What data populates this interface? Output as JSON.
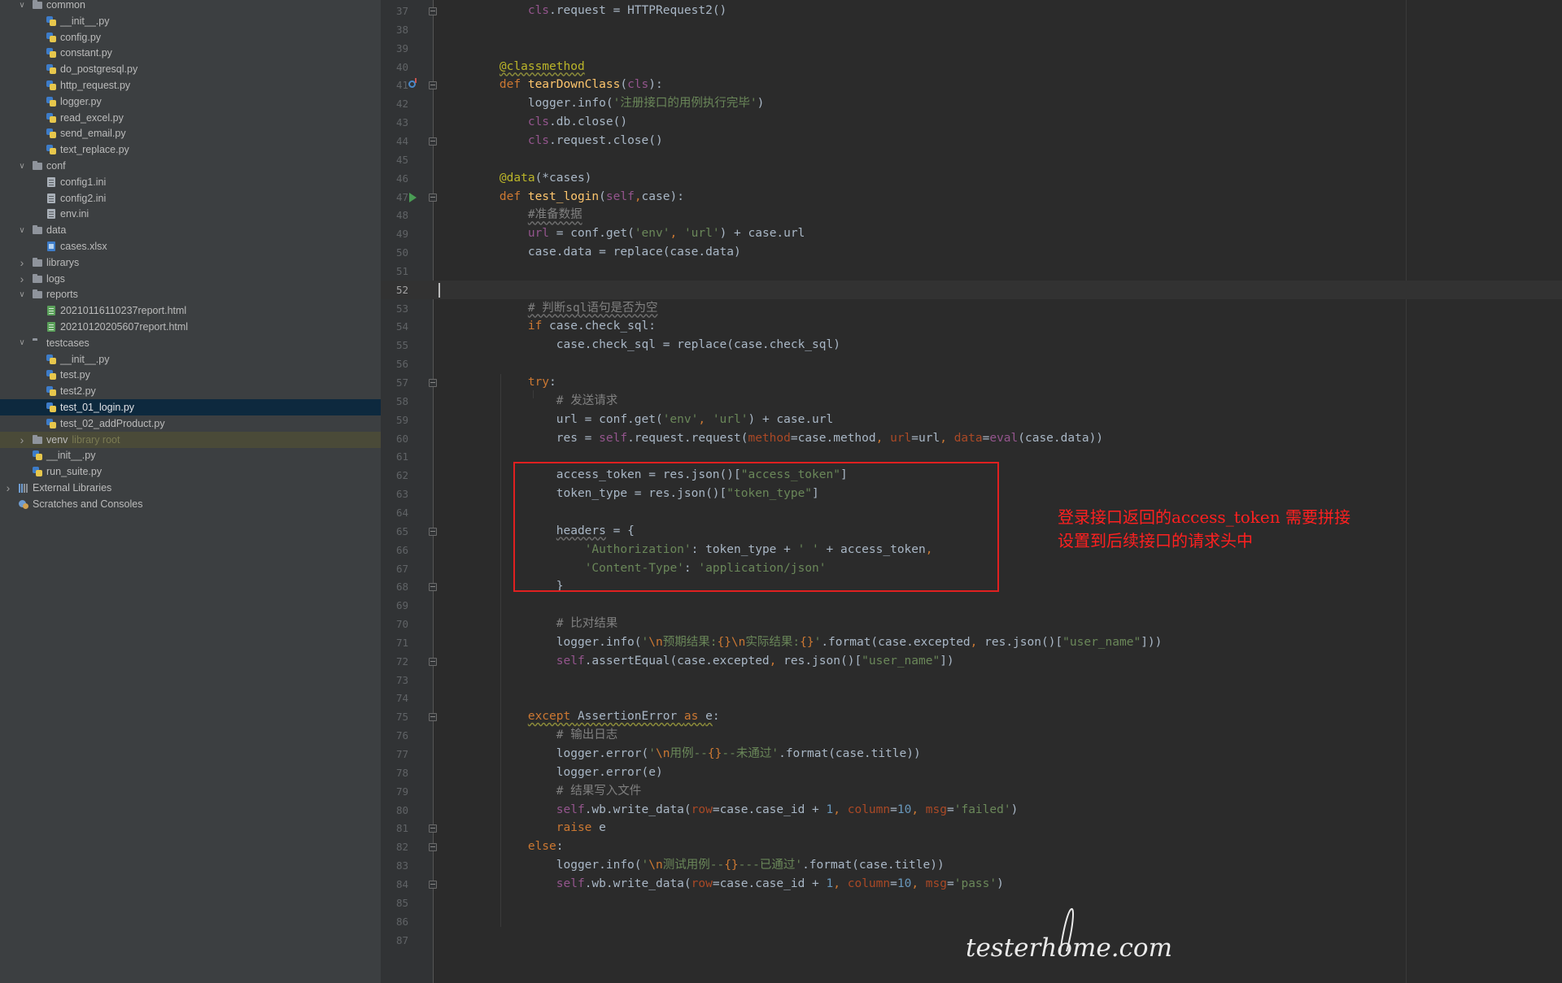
{
  "project_tree": [
    {
      "label": "common",
      "type": "folder",
      "icon": "folder-icon",
      "depth": 1,
      "arrow": "expanded"
    },
    {
      "label": "__init__.py",
      "type": "py",
      "icon": "python-file-icon",
      "depth": 2
    },
    {
      "label": "config.py",
      "type": "py",
      "icon": "python-file-icon",
      "depth": 2
    },
    {
      "label": "constant.py",
      "type": "py",
      "icon": "python-file-icon",
      "depth": 2
    },
    {
      "label": "do_postgresql.py",
      "type": "py",
      "icon": "python-file-icon",
      "depth": 2
    },
    {
      "label": "http_request.py",
      "type": "py",
      "icon": "python-file-icon",
      "depth": 2
    },
    {
      "label": "logger.py",
      "type": "py",
      "icon": "python-file-icon",
      "depth": 2
    },
    {
      "label": "read_excel.py",
      "type": "py",
      "icon": "python-file-icon",
      "depth": 2
    },
    {
      "label": "send_email.py",
      "type": "py",
      "icon": "python-file-icon",
      "depth": 2
    },
    {
      "label": "text_replace.py",
      "type": "py",
      "icon": "python-file-icon",
      "depth": 2
    },
    {
      "label": "conf",
      "type": "folder",
      "icon": "folder-icon",
      "depth": 1,
      "arrow": "expanded"
    },
    {
      "label": "config1.ini",
      "type": "ini",
      "icon": "ini-file-icon",
      "depth": 2
    },
    {
      "label": "config2.ini",
      "type": "ini",
      "icon": "ini-file-icon",
      "depth": 2
    },
    {
      "label": "env.ini",
      "type": "ini",
      "icon": "ini-file-icon",
      "depth": 2
    },
    {
      "label": "data",
      "type": "folder",
      "icon": "folder-icon",
      "depth": 1,
      "arrow": "expanded"
    },
    {
      "label": "cases.xlsx",
      "type": "xlsx",
      "icon": "excel-file-icon",
      "depth": 2
    },
    {
      "label": "librarys",
      "type": "folder",
      "icon": "folder-icon",
      "depth": 1,
      "arrow": "collapsed"
    },
    {
      "label": "logs",
      "type": "folder",
      "icon": "folder-icon",
      "depth": 1,
      "arrow": "collapsed"
    },
    {
      "label": "reports",
      "type": "folder",
      "icon": "folder-icon",
      "depth": 1,
      "arrow": "expanded"
    },
    {
      "label": "20210116110237report.html",
      "type": "html",
      "icon": "html-file-icon",
      "depth": 2
    },
    {
      "label": "20210120205607report.html",
      "type": "html",
      "icon": "html-file-icon",
      "depth": 2
    },
    {
      "label": "testcases",
      "type": "pkg",
      "icon": "package-folder-icon",
      "depth": 1,
      "arrow": "expanded"
    },
    {
      "label": "__init__.py",
      "type": "py",
      "icon": "python-file-icon",
      "depth": 2
    },
    {
      "label": "test.py",
      "type": "py",
      "icon": "python-file-icon",
      "depth": 2
    },
    {
      "label": "test2.py",
      "type": "py",
      "icon": "python-file-icon",
      "depth": 2
    },
    {
      "label": "test_01_login.py",
      "type": "py",
      "icon": "python-file-icon",
      "depth": 2,
      "selected": true
    },
    {
      "label": "test_02_addProduct.py",
      "type": "py",
      "icon": "python-file-icon",
      "depth": 2
    },
    {
      "label": "venv",
      "type": "folder",
      "icon": "folder-icon",
      "depth": 1,
      "arrow": "collapsed",
      "hint": "library root",
      "excluded": true
    },
    {
      "label": "__init__.py",
      "type": "py",
      "icon": "python-file-icon",
      "depth": 1
    },
    {
      "label": "run_suite.py",
      "type": "py",
      "icon": "python-file-icon",
      "depth": 1
    },
    {
      "label": "External Libraries",
      "type": "lib",
      "icon": "external-libraries-icon",
      "depth": 0,
      "arrow": "collapsed"
    },
    {
      "label": "Scratches and Consoles",
      "type": "scratch",
      "icon": "scratches-icon",
      "depth": 0
    }
  ],
  "editor": {
    "current_line": 52,
    "code_lines": [
      {
        "n": 37,
        "fold": true,
        "t": [
          [
            "",
            "        "
          ],
          [
            "selfc",
            "cls"
          ],
          [
            "",
            ".request = HTTPRequest2()"
          ]
        ]
      },
      {
        "n": 38,
        "t": []
      },
      {
        "n": 39,
        "t": []
      },
      {
        "n": 40,
        "t": [
          [
            "",
            "    "
          ],
          [
            "deco wave",
            "@classmethod"
          ]
        ]
      },
      {
        "n": 41,
        "fold": true,
        "marker": "override",
        "t": [
          [
            "",
            "    "
          ],
          [
            "kw",
            "def "
          ],
          [
            "fn",
            "tearDownClass"
          ],
          [
            "",
            "("
          ],
          [
            "selfc",
            "cls"
          ],
          [
            "",
            "):"
          ]
        ]
      },
      {
        "n": 42,
        "t": [
          [
            "",
            "        logger.info("
          ],
          [
            "str",
            "'注册接口的用例执行完毕'"
          ],
          [
            "",
            ")"
          ]
        ]
      },
      {
        "n": 43,
        "t": [
          [
            "",
            "        "
          ],
          [
            "selfc",
            "cls"
          ],
          [
            "",
            ".db.close()"
          ]
        ]
      },
      {
        "n": 44,
        "fold": true,
        "t": [
          [
            "",
            "        "
          ],
          [
            "selfc",
            "cls"
          ],
          [
            "",
            ".request.close()"
          ]
        ]
      },
      {
        "n": 45,
        "t": []
      },
      {
        "n": 46,
        "t": [
          [
            "",
            "    "
          ],
          [
            "deco",
            "@data"
          ],
          [
            "",
            "(*cases)"
          ]
        ]
      },
      {
        "n": 47,
        "fold": true,
        "marker": "run",
        "t": [
          [
            "",
            "    "
          ],
          [
            "kw",
            "def "
          ],
          [
            "fn",
            "test_login"
          ],
          [
            "",
            "("
          ],
          [
            "selfc",
            "self"
          ],
          [
            "kw",
            ","
          ],
          [
            "",
            "case):"
          ]
        ]
      },
      {
        "n": 48,
        "t": [
          [
            "",
            "        "
          ],
          [
            "cmt wave-gray",
            "#准备数据"
          ]
        ]
      },
      {
        "n": 49,
        "t": [
          [
            "",
            "        "
          ],
          [
            "selfc",
            "url"
          ],
          [
            "",
            " = conf.get("
          ],
          [
            "str",
            "'env'"
          ],
          [
            "kw",
            ", "
          ],
          [
            "str",
            "'url'"
          ],
          [
            "",
            ") + case.url"
          ]
        ]
      },
      {
        "n": 50,
        "t": [
          [
            "",
            "        case.data = replace(case.data)"
          ]
        ]
      },
      {
        "n": 51,
        "t": []
      },
      {
        "n": 52,
        "t": []
      },
      {
        "n": 53,
        "t": [
          [
            "",
            "        "
          ],
          [
            "cmt wave-gray",
            "# 判断sql语句是否为空"
          ]
        ]
      },
      {
        "n": 54,
        "t": [
          [
            "",
            "        "
          ],
          [
            "kw",
            "if "
          ],
          [
            "",
            "case.check_sql:"
          ]
        ]
      },
      {
        "n": 55,
        "t": [
          [
            "",
            "            case.check_sql = replace(case.check_sql)"
          ]
        ]
      },
      {
        "n": 56,
        "t": []
      },
      {
        "n": 57,
        "fold": true,
        "t": [
          [
            "",
            "        "
          ],
          [
            "kw",
            "try"
          ],
          [
            "",
            ":"
          ]
        ]
      },
      {
        "n": 58,
        "t": [
          [
            "",
            "            "
          ],
          [
            "cmt",
            "# 发送请求"
          ]
        ]
      },
      {
        "n": 59,
        "t": [
          [
            "",
            "            url = conf.get("
          ],
          [
            "str",
            "'env'"
          ],
          [
            "kw",
            ", "
          ],
          [
            "str",
            "'url'"
          ],
          [
            "",
            ") + case.url"
          ]
        ]
      },
      {
        "n": 60,
        "t": [
          [
            "",
            "            res = "
          ],
          [
            "selfc",
            "self"
          ],
          [
            "",
            ".request.request("
          ],
          [
            "param",
            "method"
          ],
          [
            "",
            "=case.method"
          ],
          [
            "kw",
            ", "
          ],
          [
            "param",
            "url"
          ],
          [
            "",
            "=url"
          ],
          [
            "kw",
            ", "
          ],
          [
            "param",
            "data"
          ],
          [
            "",
            "="
          ],
          [
            "selfc",
            "eval"
          ],
          [
            "",
            "(case.data))"
          ]
        ]
      },
      {
        "n": 61,
        "t": []
      },
      {
        "n": 62,
        "t": [
          [
            "",
            "            access_token = res.json()["
          ],
          [
            "str",
            "\"access_token\""
          ],
          [
            "",
            "]"
          ]
        ]
      },
      {
        "n": 63,
        "t": [
          [
            "",
            "            token_type = res.json()["
          ],
          [
            "str",
            "\"token_type\""
          ],
          [
            "",
            "]"
          ]
        ]
      },
      {
        "n": 64,
        "t": []
      },
      {
        "n": 65,
        "fold": true,
        "t": [
          [
            "",
            "            "
          ],
          [
            "plain wave-gray",
            "headers"
          ],
          [
            "",
            " = {"
          ]
        ]
      },
      {
        "n": 66,
        "t": [
          [
            "",
            "                "
          ],
          [
            "str",
            "'Authorization'"
          ],
          [
            "",
            ": token_type + "
          ],
          [
            "str",
            "' '"
          ],
          [
            "",
            " + access_token"
          ],
          [
            "kw",
            ","
          ]
        ]
      },
      {
        "n": 67,
        "t": [
          [
            "",
            "                "
          ],
          [
            "str",
            "'Content-Type'"
          ],
          [
            "",
            ": "
          ],
          [
            "str",
            "'application/json'"
          ]
        ]
      },
      {
        "n": 68,
        "fold": true,
        "t": [
          [
            "",
            "            }"
          ]
        ]
      },
      {
        "n": 69,
        "t": []
      },
      {
        "n": 70,
        "t": [
          [
            "",
            "            "
          ],
          [
            "cmt",
            "# 比对结果"
          ]
        ]
      },
      {
        "n": 71,
        "t": [
          [
            "",
            "            logger.info("
          ],
          [
            "str",
            "'"
          ],
          [
            "esc",
            "\\n"
          ],
          [
            "str",
            "预期结果:"
          ],
          [
            "esc",
            "{}"
          ],
          [
            "esc",
            "\\n"
          ],
          [
            "str",
            "实际结果:"
          ],
          [
            "esc",
            "{}"
          ],
          [
            "str",
            "'"
          ],
          [
            "",
            ".format(case.excepted"
          ],
          [
            "kw",
            ", "
          ],
          [
            "",
            "res.json()["
          ],
          [
            "str",
            "\"user_name\""
          ],
          [
            "",
            "]))"
          ]
        ]
      },
      {
        "n": 72,
        "fold": true,
        "t": [
          [
            "",
            "            "
          ],
          [
            "selfc",
            "self"
          ],
          [
            "",
            ".assertEqual(case.excepted"
          ],
          [
            "kw",
            ", "
          ],
          [
            "",
            "res.json()["
          ],
          [
            "str",
            "\"user_name\""
          ],
          [
            "",
            "])"
          ]
        ]
      },
      {
        "n": 73,
        "t": []
      },
      {
        "n": 74,
        "t": []
      },
      {
        "n": 75,
        "fold": true,
        "t": [
          [
            "",
            "        "
          ],
          [
            "kw wave",
            "except "
          ],
          [
            "plain wave",
            "AssertionError "
          ],
          [
            "kw wave",
            "as "
          ],
          [
            "plain wave",
            "e"
          ],
          [
            "",
            ":"
          ]
        ]
      },
      {
        "n": 76,
        "t": [
          [
            "",
            "            "
          ],
          [
            "cmt",
            "# 输出日志"
          ]
        ]
      },
      {
        "n": 77,
        "t": [
          [
            "",
            "            logger.error("
          ],
          [
            "str",
            "'"
          ],
          [
            "esc",
            "\\n"
          ],
          [
            "str",
            "用例--"
          ],
          [
            "esc",
            "{}"
          ],
          [
            "str",
            "--未通过'"
          ],
          [
            "",
            ".format(case.title))"
          ]
        ]
      },
      {
        "n": 78,
        "t": [
          [
            "",
            "            logger.error(e)"
          ]
        ]
      },
      {
        "n": 79,
        "t": [
          [
            "",
            "            "
          ],
          [
            "cmt",
            "# 结果写入文件"
          ]
        ]
      },
      {
        "n": 80,
        "t": [
          [
            "",
            "            "
          ],
          [
            "selfc",
            "self"
          ],
          [
            "",
            ".wb.write_data("
          ],
          [
            "param",
            "row"
          ],
          [
            "",
            "=case.case_id + "
          ],
          [
            "num",
            "1"
          ],
          [
            "kw",
            ", "
          ],
          [
            "param",
            "column"
          ],
          [
            "",
            "="
          ],
          [
            "num",
            "10"
          ],
          [
            "kw",
            ", "
          ],
          [
            "param",
            "msg"
          ],
          [
            "",
            "="
          ],
          [
            "str",
            "'failed'"
          ],
          [
            "",
            ")"
          ]
        ]
      },
      {
        "n": 81,
        "fold": true,
        "t": [
          [
            "",
            "            "
          ],
          [
            "kw",
            "raise "
          ],
          [
            "",
            "e"
          ]
        ]
      },
      {
        "n": 82,
        "fold": true,
        "t": [
          [
            "",
            "        "
          ],
          [
            "kw",
            "else"
          ],
          [
            "",
            ":"
          ]
        ]
      },
      {
        "n": 83,
        "t": [
          [
            "",
            "            logger.info("
          ],
          [
            "str",
            "'"
          ],
          [
            "esc",
            "\\n"
          ],
          [
            "str",
            "测试用例--"
          ],
          [
            "esc",
            "{}"
          ],
          [
            "str",
            "---已通过'"
          ],
          [
            "",
            ".format(case.title))"
          ]
        ]
      },
      {
        "n": 84,
        "fold": true,
        "t": [
          [
            "",
            "            "
          ],
          [
            "selfc",
            "self"
          ],
          [
            "",
            ".wb.write_data("
          ],
          [
            "param",
            "row"
          ],
          [
            "",
            "=case.case_id + "
          ],
          [
            "num",
            "1"
          ],
          [
            "kw",
            ", "
          ],
          [
            "param",
            "column"
          ],
          [
            "",
            "="
          ],
          [
            "num",
            "10"
          ],
          [
            "kw",
            ", "
          ],
          [
            "param",
            "msg"
          ],
          [
            "",
            "="
          ],
          [
            "str",
            "'pass'"
          ],
          [
            "",
            ")"
          ]
        ]
      },
      {
        "n": 85,
        "t": []
      },
      {
        "n": 86,
        "t": []
      },
      {
        "n": 87,
        "t": []
      }
    ]
  },
  "annotation": {
    "line1": "登录接口返回的access_token  需要拼接",
    "line2": "设置到后续接口的请求头中",
    "color": "#ff2020"
  },
  "watermark": {
    "text": "testerhome.com"
  },
  "colors": {
    "sidebar_bg": "#3c3f41",
    "editor_bg": "#2b2b2b",
    "selection": "#0d293e",
    "keyword": "#cc7832",
    "string": "#6a8759",
    "function": "#ffc66d"
  }
}
